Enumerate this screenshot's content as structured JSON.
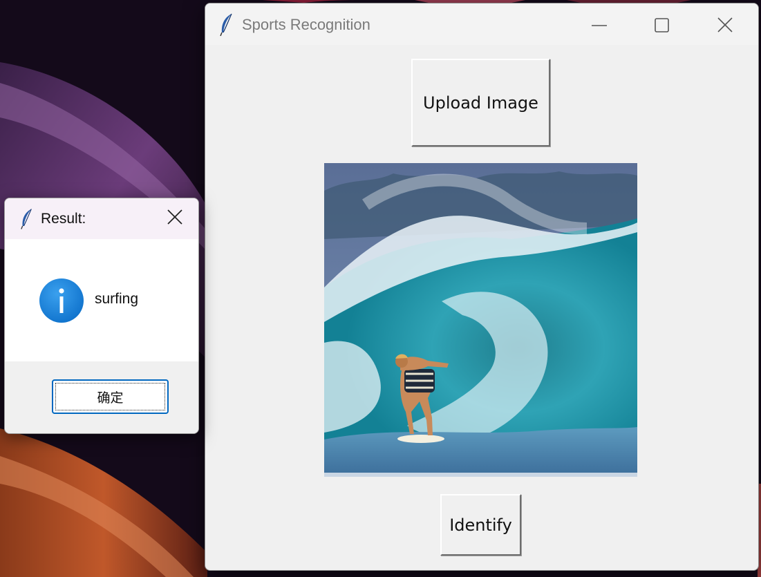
{
  "main_window": {
    "title": "Sports Recognition",
    "upload_label": "Upload Image",
    "identify_label": "Identify",
    "image_subject": "surfer riding inside a breaking wave",
    "controls": [
      "minimize-icon",
      "maximize-icon",
      "close-icon"
    ]
  },
  "dialog": {
    "title": "Result:",
    "message": "surfing",
    "ok_label": "确定",
    "icon": "info-icon"
  },
  "colors": {
    "accent": "#0067c0",
    "info_icon": "#1a8ae0",
    "window_bg": "#f0f0f0"
  }
}
